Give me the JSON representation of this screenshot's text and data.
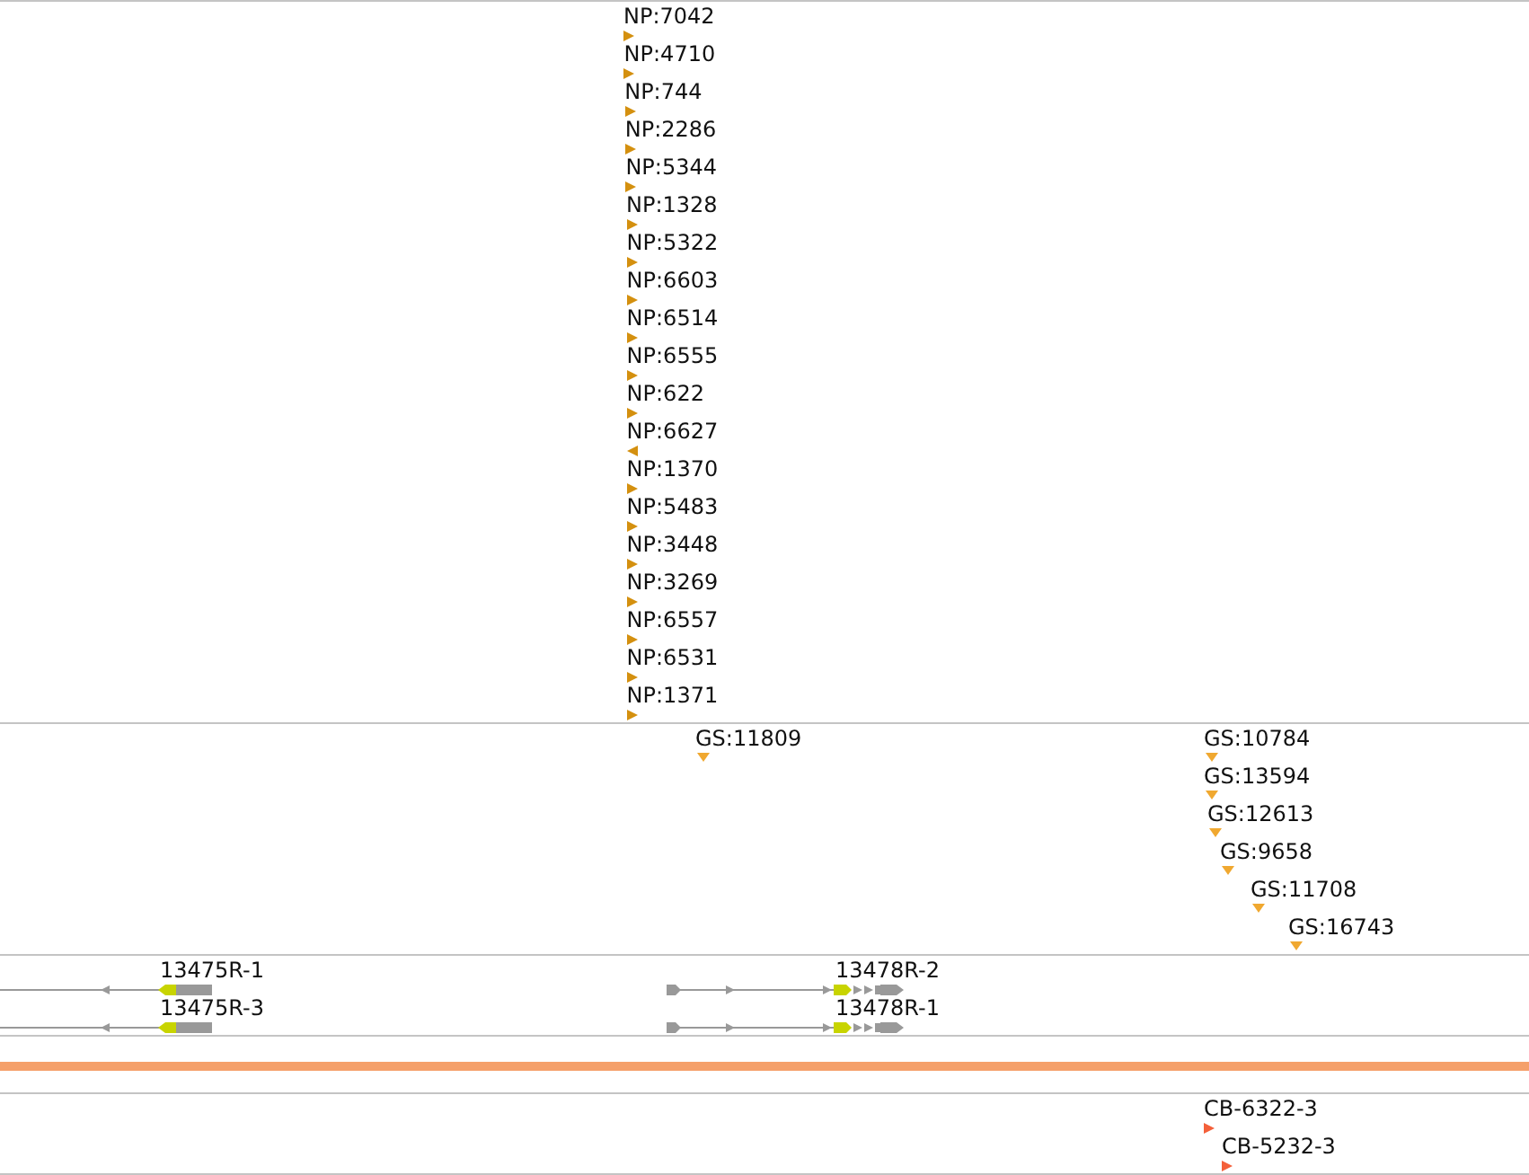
{
  "np_track": {
    "features": [
      {
        "label": "NP:7042",
        "kind": "forward"
      },
      {
        "label": "NP:4710",
        "kind": "forward"
      },
      {
        "label": "NP:744",
        "kind": "forward"
      },
      {
        "label": "NP:2286",
        "kind": "forward"
      },
      {
        "label": "NP:5344",
        "kind": "forward"
      },
      {
        "label": "NP:1328",
        "kind": "forward"
      },
      {
        "label": "NP:5322",
        "kind": "forward"
      },
      {
        "label": "NP:6603",
        "kind": "forward"
      },
      {
        "label": "NP:6514",
        "kind": "forward"
      },
      {
        "label": "NP:6555",
        "kind": "forward"
      },
      {
        "label": "NP:622",
        "kind": "forward"
      },
      {
        "label": "NP:6627",
        "kind": "reverse"
      },
      {
        "label": "NP:1370",
        "kind": "forward"
      },
      {
        "label": "NP:5483",
        "kind": "forward"
      },
      {
        "label": "NP:3448",
        "kind": "forward"
      },
      {
        "label": "NP:3269",
        "kind": "forward"
      },
      {
        "label": "NP:6557",
        "kind": "forward"
      },
      {
        "label": "NP:6531",
        "kind": "forward"
      },
      {
        "label": "NP:1371",
        "kind": "forward"
      }
    ]
  },
  "gs_track": {
    "features": [
      {
        "label": "GS:11809"
      },
      {
        "label": "GS:10784"
      },
      {
        "label": "GS:13594"
      },
      {
        "label": "GS:12613"
      },
      {
        "label": "GS:9658"
      },
      {
        "label": "GS:11708"
      },
      {
        "label": "GS:16743"
      }
    ]
  },
  "gene_track": {
    "rows": [
      {
        "genes": [
          {
            "label": "13475R-1",
            "kind": "reverse"
          },
          {
            "label": "13478R-2",
            "kind": "forward"
          }
        ]
      },
      {
        "genes": [
          {
            "label": "13475R-3",
            "kind": "reverse"
          },
          {
            "label": "13478R-1",
            "kind": "forward"
          }
        ]
      }
    ]
  },
  "cb_track": {
    "features": [
      {
        "label": "CB-6322-3",
        "kind": "forward"
      },
      {
        "label": "CB-5232-3",
        "kind": "forward"
      }
    ]
  }
}
